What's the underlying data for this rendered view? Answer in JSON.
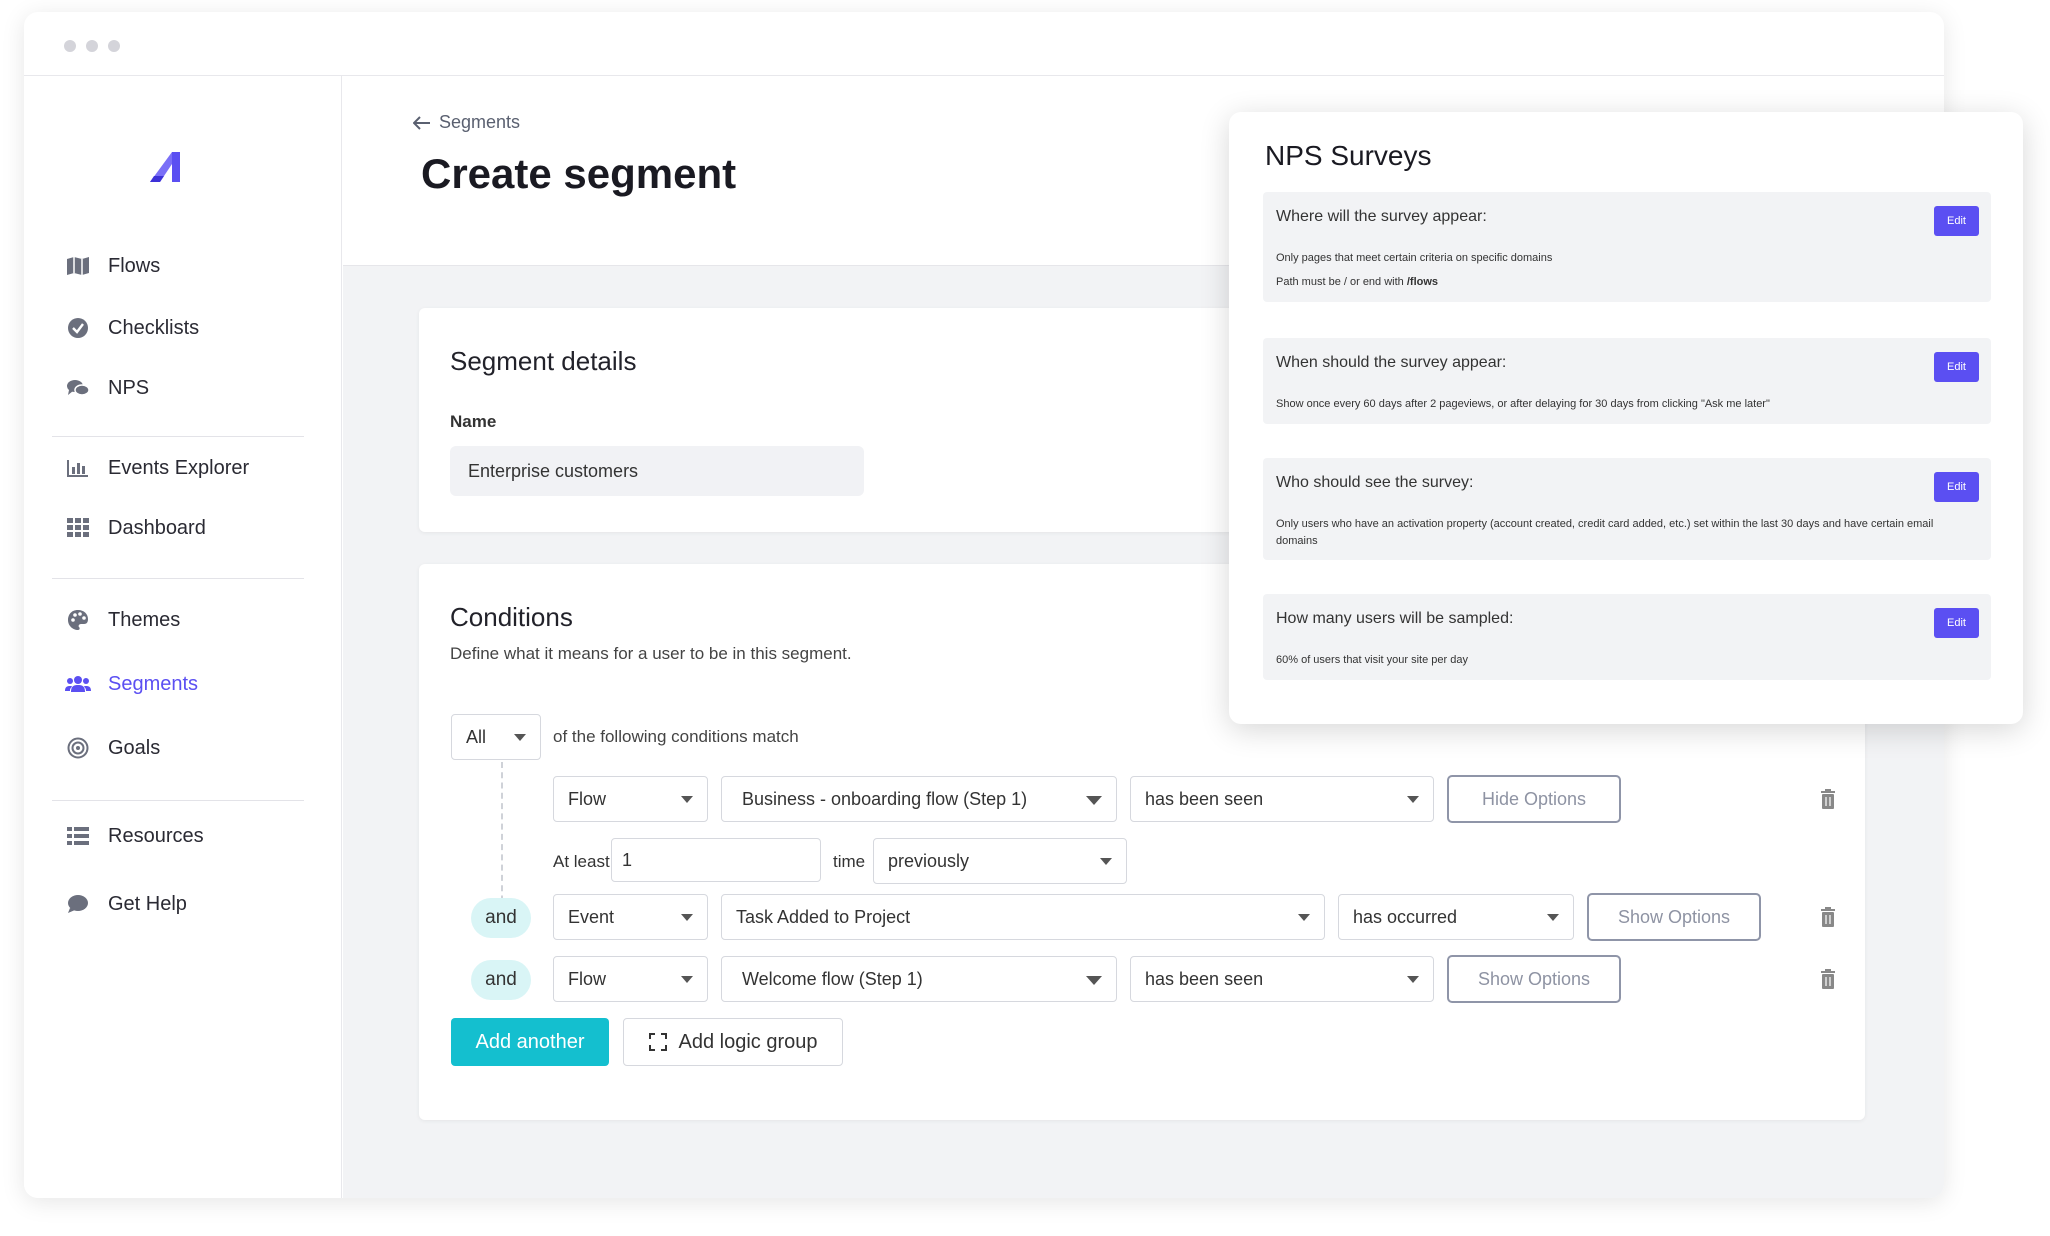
{
  "sidebar": {
    "items": [
      {
        "label": "Flows",
        "icon": "map-icon"
      },
      {
        "label": "Checklists",
        "icon": "check-circle-icon"
      },
      {
        "label": "NPS",
        "icon": "chat-bubbles-icon"
      },
      {
        "label": "Events Explorer",
        "icon": "bar-chart-icon"
      },
      {
        "label": "Dashboard",
        "icon": "grid-icon"
      },
      {
        "label": "Themes",
        "icon": "palette-icon"
      },
      {
        "label": "Segments",
        "icon": "users-icon"
      },
      {
        "label": "Goals",
        "icon": "target-icon"
      },
      {
        "label": "Resources",
        "icon": "list-icon"
      },
      {
        "label": "Get Help",
        "icon": "chat-icon"
      }
    ],
    "active": "Segments"
  },
  "header": {
    "breadcrumb": "Segments",
    "title": "Create segment"
  },
  "segment_details": {
    "title": "Segment details",
    "name_label": "Name",
    "name_value": "Enterprise customers"
  },
  "conditions": {
    "title": "Conditions",
    "description": "Define what it means for a user to be in this segment.",
    "match_select": "All",
    "match_text": "of the following conditions match",
    "row1": {
      "type": "Flow",
      "target": "Business - onboarding flow (Step 1)",
      "operator": "has been seen",
      "options_btn": "Hide Options",
      "at_least_label": "At least",
      "count_value": "1",
      "time_label": "time",
      "when": "previously"
    },
    "row2": {
      "connector": "and",
      "type": "Event",
      "target": "Task Added to Project",
      "operator": "has occurred",
      "options_btn": "Show Options"
    },
    "row3": {
      "connector": "and",
      "type": "Flow",
      "target": "Welcome flow (Step 1)",
      "operator": "has been seen",
      "options_btn": "Show Options"
    },
    "add_another": "Add another",
    "add_logic_group": "Add logic group"
  },
  "nps_panel": {
    "title": "NPS Surveys",
    "edit_label": "Edit",
    "sections": [
      {
        "question": "Where will the survey appear:",
        "line1": "Only pages that meet certain criteria on specific domains",
        "line2_prefix": "Path must be / or end with ",
        "line2_bold": "/flows"
      },
      {
        "question": "When should the survey appear:",
        "line1": "Show once every 60 days after 2 pageviews, or after delaying for 30 days from clicking \"Ask me later\""
      },
      {
        "question": "Who should see the survey:",
        "line1": "Only users who have an activation property (account created, credit card added, etc.) set within the last 30 days and have certain email domains"
      },
      {
        "question": "How many users will be sampled:",
        "line1": "60% of users that visit your site per day"
      }
    ]
  },
  "colors": {
    "accent": "#5b4ff2",
    "primary_button": "#14bfcf",
    "and_pill": "#d9f5f6"
  }
}
